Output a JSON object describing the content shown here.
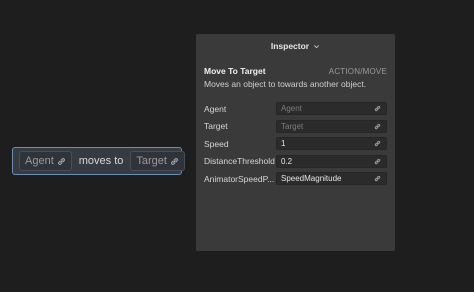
{
  "node": {
    "chip_agent": "Agent",
    "middle_text": "moves to",
    "chip_target": "Target"
  },
  "inspector": {
    "header": "Inspector",
    "title": "Move To Target",
    "category": "ACTION/MOVE",
    "description": "Moves an object to towards another object.",
    "properties": [
      {
        "label": "Agent",
        "value": "Agent",
        "placeholder": true,
        "icon": "link-icon"
      },
      {
        "label": "Target",
        "value": "Target",
        "placeholder": true,
        "icon": "link-icon"
      },
      {
        "label": "Speed",
        "value": "1",
        "placeholder": false,
        "icon": "link-icon"
      },
      {
        "label": "DistanceThreshold",
        "value": "0.2",
        "placeholder": false,
        "icon": "link-icon"
      },
      {
        "label": "AnimatorSpeedP...",
        "value": "SpeedMagnitude",
        "placeholder": false,
        "icon": "link-icon"
      }
    ]
  },
  "colors": {
    "background": "#1e1e1e",
    "panel": "#3a3a3a",
    "node_border": "#6b8fb3"
  }
}
